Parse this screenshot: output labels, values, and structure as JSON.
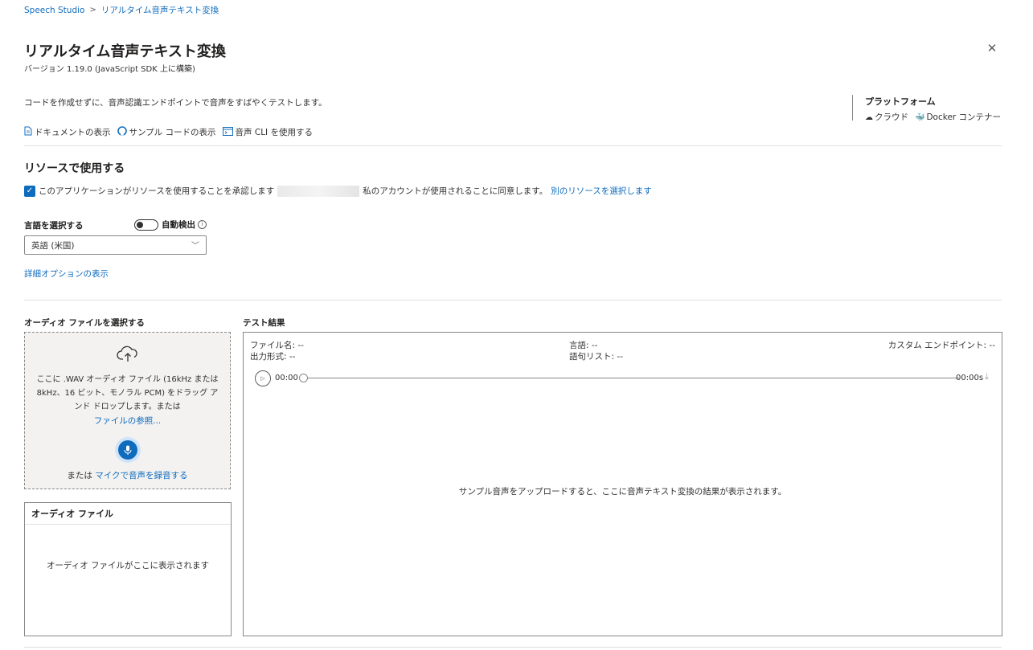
{
  "breadcrumb": {
    "root": "Speech Studio",
    "separator": ">",
    "current": "リアルタイム音声テキスト変換"
  },
  "page": {
    "title": "リアルタイム音声テキスト変換",
    "version": "バージョン 1.19.0 (JavaScript SDK 上に構築)",
    "description": "コードを作成せずに、音声認識エンドポイントで音声をすばやくテストします。",
    "close_icon": "close-icon"
  },
  "platform": {
    "title": "プラットフォーム",
    "items": [
      {
        "icon": "cloud-icon",
        "label": "クラウド"
      },
      {
        "icon": "docker-icon",
        "label": "Docker コンテナー"
      }
    ]
  },
  "doc_links": [
    {
      "icon": "document-icon",
      "label": "ドキュメントの表示"
    },
    {
      "icon": "github-icon",
      "label": "サンプル コードの表示"
    },
    {
      "icon": "terminal-icon",
      "label": "音声 CLI を使用する"
    }
  ],
  "resource": {
    "title": "リソースで使用する",
    "consent_text_1": "このアプリケーションがリソースを使用することを承認します",
    "consent_text_2": "私のアカウントが使用されることに同意します。",
    "select_other": "別のリソースを選択します",
    "checked": true
  },
  "language": {
    "label": "言語を選択する",
    "auto_detect_label": "自動検出",
    "auto_detect_on": false,
    "selected": "英語 (米国)"
  },
  "advanced_options": "詳細オプションの表示",
  "audio_select": {
    "title": "オーディオ ファイルを選択する",
    "drop_text": "ここに .WAV オーディオ ファイル (16kHz または 8kHz、16 ビット、モノラル PCM) をドラッグ アンド ドロップします。または",
    "browse": "ファイルの参照...",
    "or": "または",
    "record": "マイクで音声を録音する"
  },
  "audio_files": {
    "title": "オーディオ ファイル",
    "empty": "オーディオ ファイルがここに表示されます"
  },
  "results": {
    "title": "テスト結果",
    "file_name": "ファイル名: --",
    "output_format": "出力形式: --",
    "language": "言語: --",
    "phrase_list": "語句リスト: --",
    "custom_endpoint": "カスタム エンドポイント: --",
    "time_start": "00:00",
    "time_end": "00:00s",
    "progress": 0,
    "placeholder": "サンプル音声をアップロードすると、ここに音声テキスト変換の結果が表示されます。"
  },
  "colors": {
    "accent": "#0f6cbd",
    "dropzone_bg": "#f3f2f1",
    "border": "#8a8886"
  }
}
